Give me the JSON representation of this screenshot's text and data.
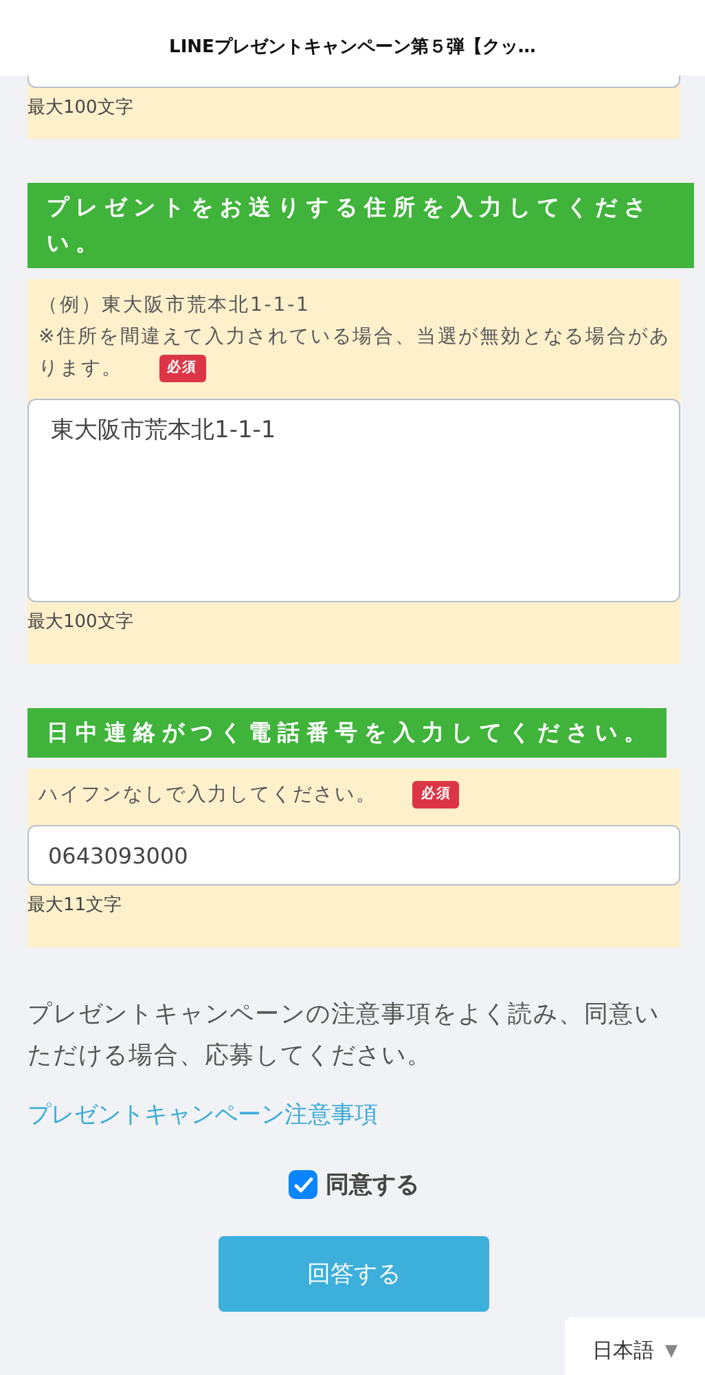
{
  "header": {
    "title": "LINEプレゼントキャンペーン第５弾【クッ…"
  },
  "sections": [
    {
      "kind": "cut",
      "counter": "最大100文字"
    },
    {
      "heading": "プレゼントをお送りする住所を入力してください。",
      "hint": [
        "（例）東大阪市荒本北1-1-1",
        "※住所を間違えて入力されている場合、当選が無効となる場合があります。"
      ],
      "required": "必須",
      "kind": "textarea",
      "value": "東大阪市荒本北1-1-1",
      "counter": "最大100文字"
    },
    {
      "heading": "日中連絡がつく電話番号を入力してください。",
      "hint": [
        "ハイフンなしで入力してください。"
      ],
      "required": "必須",
      "kind": "input",
      "value": "0643093000",
      "counter": "最大11文字"
    }
  ],
  "notice": "プレゼントキャンペーンの注意事項をよく読み、同意いただける場合、応募してください。",
  "notice_link": "プレゼントキャンペーン注意事項",
  "agree": {
    "label": "同意する",
    "checked": true
  },
  "submit": "回答する",
  "language": {
    "label": "日本語",
    "arrow": "▼"
  }
}
